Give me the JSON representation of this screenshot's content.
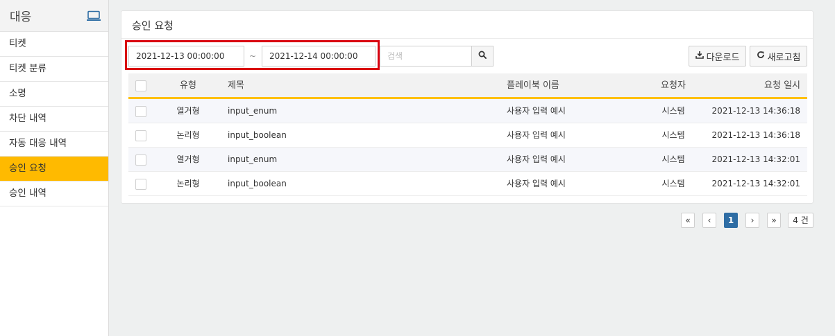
{
  "sidebar": {
    "title": "대응",
    "header_icon": "laptop-icon",
    "items": [
      {
        "label": "티켓",
        "active": false
      },
      {
        "label": "티켓 분류",
        "active": false
      },
      {
        "label": "소명",
        "active": false
      },
      {
        "label": "차단 내역",
        "active": false
      },
      {
        "label": "자동 대응 내역",
        "active": false
      },
      {
        "label": "승인 요청",
        "active": true
      },
      {
        "label": "승인 내역",
        "active": false
      }
    ]
  },
  "panel": {
    "title": "승인 요청"
  },
  "filters": {
    "start_date": "2021-12-13 00:00:00",
    "separator": "~",
    "end_date": "2021-12-14 00:00:00",
    "search_placeholder": "검색",
    "download_label": "다운로드",
    "refresh_label": "새로고침"
  },
  "table": {
    "headers": {
      "type": "유형",
      "title": "제목",
      "playbook": "플레이북 이름",
      "requester": "요청자",
      "date": "요청 일시"
    },
    "rows": [
      {
        "type": "열거형",
        "title": "input_enum",
        "playbook": "사용자 입력 예시",
        "requester": "시스템",
        "date": "2021-12-13 14:36:18"
      },
      {
        "type": "논리형",
        "title": "input_boolean",
        "playbook": "사용자 입력 예시",
        "requester": "시스템",
        "date": "2021-12-13 14:36:18"
      },
      {
        "type": "열거형",
        "title": "input_enum",
        "playbook": "사용자 입력 예시",
        "requester": "시스템",
        "date": "2021-12-13 14:32:01"
      },
      {
        "type": "논리형",
        "title": "input_boolean",
        "playbook": "사용자 입력 예시",
        "requester": "시스템",
        "date": "2021-12-13 14:32:01"
      }
    ]
  },
  "pagination": {
    "first": "«",
    "prev": "‹",
    "current": "1",
    "next": "›",
    "last": "»",
    "total": "4 건"
  },
  "colors": {
    "accent": "#ffba00",
    "highlight": "#d9000f",
    "page_active": "#2e6da4"
  }
}
